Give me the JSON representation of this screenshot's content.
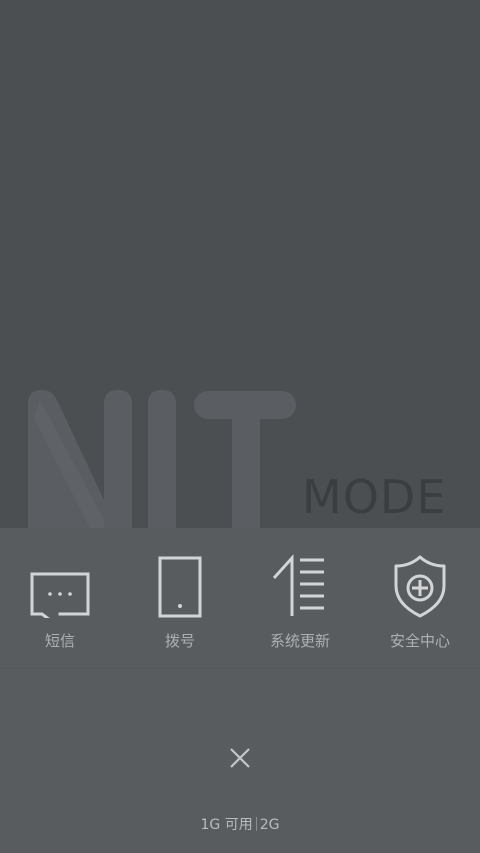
{
  "logo": {
    "word": "MODE",
    "colors": {
      "letters": "#5b5f63",
      "mode_text": "#3b3e41"
    }
  },
  "shortcuts": [
    {
      "label": "短信",
      "icon": "message-icon"
    },
    {
      "label": "拨号",
      "icon": "phone-icon"
    },
    {
      "label": "系统更新",
      "icon": "system-update-icon"
    },
    {
      "label": "安全中心",
      "icon": "shield-plus-icon"
    }
  ],
  "close": {
    "icon": "close-icon",
    "glyph": "✕"
  },
  "memory": {
    "available": "1G 可用",
    "total": "2G"
  },
  "colors": {
    "top_background": "#4b4f52",
    "panel_background": "#595c5f",
    "icon_stroke": "#d2d4d6",
    "label_text": "#aeb1b4"
  }
}
